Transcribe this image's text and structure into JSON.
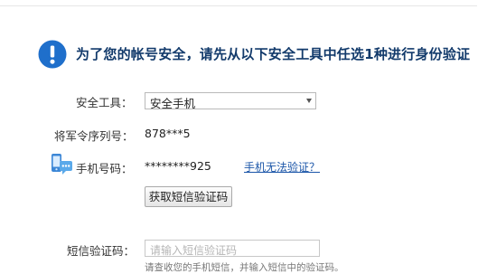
{
  "notice": {
    "icon": "info-exclamation-icon",
    "color": "#1f6fcb",
    "text": "为了您的帐号安全，请先从以下安全工具中任选1种进行身份验证"
  },
  "form": {
    "tool_label": "安全工具：",
    "tool_selected": "安全手机",
    "serial_label": "将军令序列号：",
    "serial_value": "878***5",
    "phone_icon": "mobile-phone-icon",
    "phone_label": "手机号码：",
    "phone_value": "********925",
    "phone_help_link": "手机无法验证？",
    "get_code_button": "获取短信验证码",
    "sms_label": "短信验证码：",
    "sms_placeholder": "请输入短信验证码",
    "sms_hint": "请查收您的手机短信，并输入短信中的验证码。"
  }
}
